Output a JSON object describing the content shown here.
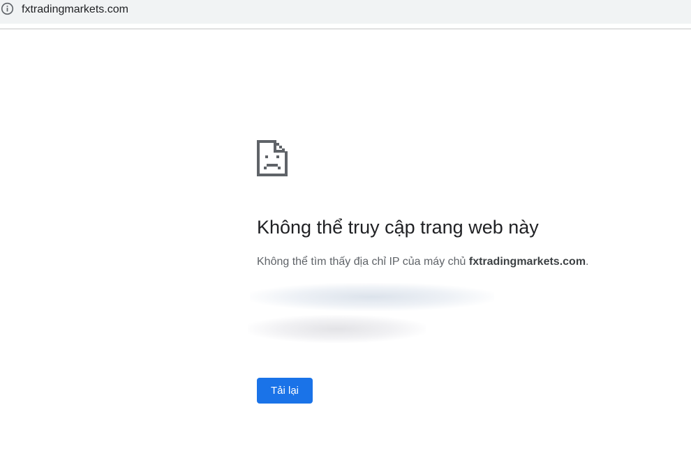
{
  "address_bar": {
    "url": "fxtradingmarkets.com",
    "info_icon": "info-circle-icon"
  },
  "error": {
    "icon": "sad-document-icon",
    "title": "Không thể truy cập trang web này",
    "message_prefix": "Không thể tìm thấy địa chỉ IP của máy chủ ",
    "host": "fxtradingmarkets.com",
    "message_suffix": ".",
    "reload_label": "Tải lại"
  },
  "colors": {
    "accent": "#1a73e8",
    "title": "#202124",
    "text": "#5f6368",
    "address_bar_bg": "#f1f3f4"
  }
}
